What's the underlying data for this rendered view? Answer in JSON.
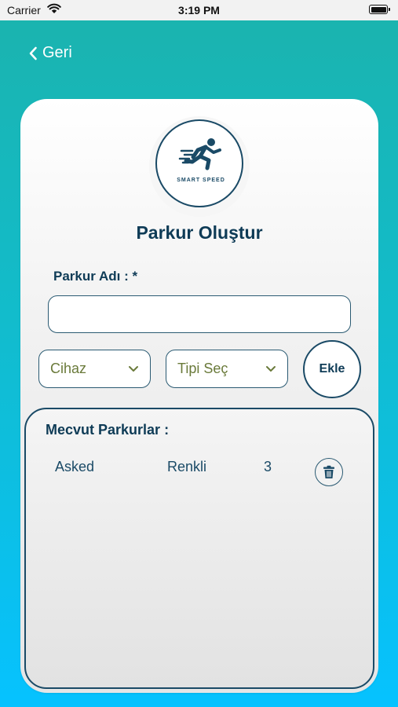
{
  "status_bar": {
    "carrier": "Carrier",
    "time": "3:19 PM"
  },
  "nav": {
    "back_label": "Geri"
  },
  "logo": {
    "text": "SMART SPEED"
  },
  "page": {
    "title": "Parkur Oluştur"
  },
  "form": {
    "name_label": "Parkur Adı : *",
    "name_value": "",
    "device_select": "Cihaz",
    "type_select": "Tipi Seç",
    "add_button": "Ekle"
  },
  "courses": {
    "title": "Mecvut Parkurlar :",
    "items": [
      {
        "name": "Asked",
        "type": "Renkli",
        "count": "3"
      }
    ]
  },
  "colors": {
    "primary": "#0e3b56",
    "accent_top": "#1bb3ad",
    "accent_bottom": "#06c2ff",
    "dropdown_text": "#6a7a3a"
  }
}
